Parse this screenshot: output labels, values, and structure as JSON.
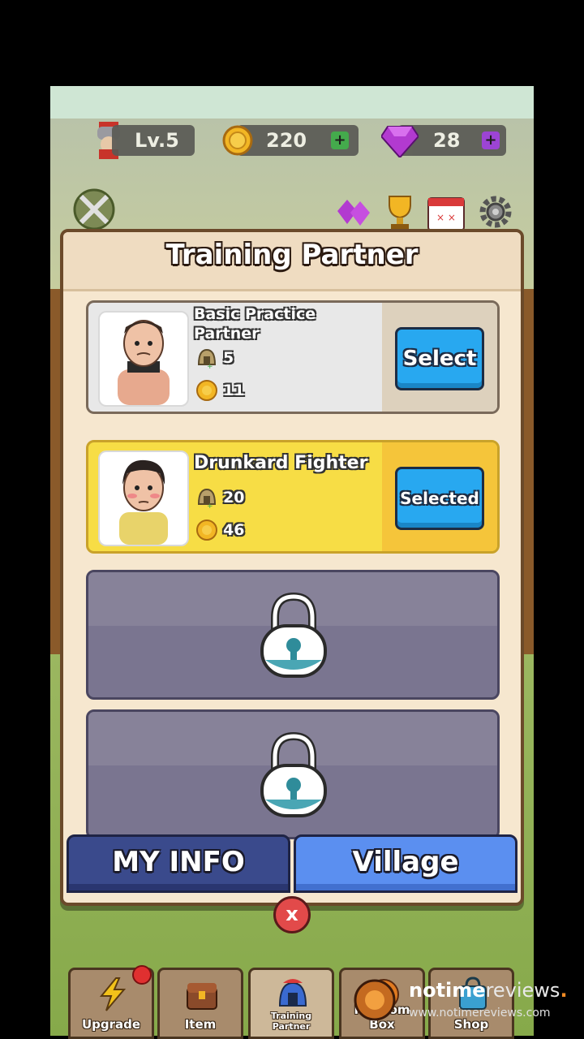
{
  "hud": {
    "level": "Lv.5",
    "gold": "220",
    "gems": "28",
    "plus_label": "+"
  },
  "panel": {
    "title": "Training Partner"
  },
  "partners": [
    {
      "name_line1": "Basic Practice",
      "name_line2": "Partner",
      "power": "5",
      "cost": "11",
      "button": "Select"
    },
    {
      "name_line1": "Drunkard Fighter",
      "power": "20",
      "cost": "46",
      "button": "Selected"
    }
  ],
  "footer": {
    "my_info": "MY INFO",
    "village": "Village",
    "close": "x"
  },
  "tabs": [
    {
      "label": "Upgrade",
      "icon": "lightning-icon"
    },
    {
      "label": "Item",
      "icon": "chest-icon"
    },
    {
      "label": "Training Partner",
      "icon": "helmet-icon"
    },
    {
      "label": "Random Box",
      "icon": "random-box-icon"
    },
    {
      "label": "Shop",
      "icon": "shop-icon"
    }
  ],
  "watermark": {
    "brand_bold": "notime",
    "brand_light": "reviews",
    "brand_dot": ".",
    "url": "www.notimereviews.com"
  }
}
